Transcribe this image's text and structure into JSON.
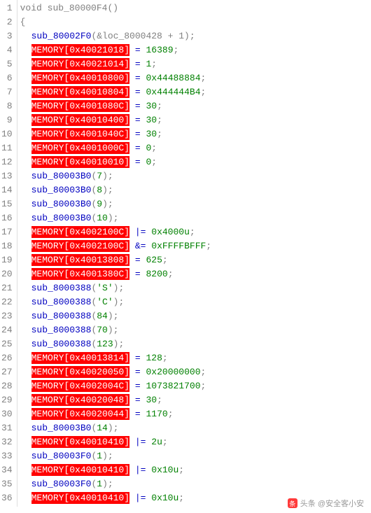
{
  "watermark": "头条 @安全客小安",
  "lines": [
    {
      "n": 1,
      "type": "decl",
      "ret": "void",
      "name": "sub_80000F4",
      "args": "",
      "close": "()"
    },
    {
      "n": 2,
      "type": "brace",
      "text": "{"
    },
    {
      "n": 3,
      "type": "call",
      "fn": "sub_80002F0",
      "args_plain": "(&loc_8000428 + 1);"
    },
    {
      "n": 4,
      "type": "mem",
      "addr": "0x40021018",
      "op": "=",
      "val": "16389"
    },
    {
      "n": 5,
      "type": "mem",
      "addr": "0x40021014",
      "op": "=",
      "val": "1"
    },
    {
      "n": 6,
      "type": "mem",
      "addr": "0x40010800",
      "op": "=",
      "val": "0x44488884"
    },
    {
      "n": 7,
      "type": "mem",
      "addr": "0x40010804",
      "op": "=",
      "val": "0x444444B4"
    },
    {
      "n": 8,
      "type": "mem",
      "addr": "0x4001080C",
      "op": "=",
      "val": "30"
    },
    {
      "n": 9,
      "type": "mem",
      "addr": "0x40010400",
      "op": "=",
      "val": "30"
    },
    {
      "n": 10,
      "type": "mem",
      "addr": "0x4001040C",
      "op": "=",
      "val": "30"
    },
    {
      "n": 11,
      "type": "mem",
      "addr": "0x4001000C",
      "op": "=",
      "val": "0"
    },
    {
      "n": 12,
      "type": "mem",
      "addr": "0x40010010",
      "op": "=",
      "val": "0"
    },
    {
      "n": 13,
      "type": "call",
      "fn": "sub_80003B0",
      "argnum": "7"
    },
    {
      "n": 14,
      "type": "call",
      "fn": "sub_80003B0",
      "argnum": "8"
    },
    {
      "n": 15,
      "type": "call",
      "fn": "sub_80003B0",
      "argnum": "9"
    },
    {
      "n": 16,
      "type": "call",
      "fn": "sub_80003B0",
      "argnum": "10"
    },
    {
      "n": 17,
      "type": "mem",
      "addr": "0x4002100C",
      "op": "|=",
      "val": "0x4000u"
    },
    {
      "n": 18,
      "type": "mem",
      "addr": "0x4002100C",
      "op": "&=",
      "val": "0xFFFFBFFF"
    },
    {
      "n": 19,
      "type": "mem",
      "addr": "0x40013808",
      "op": "=",
      "val": "625"
    },
    {
      "n": 20,
      "type": "mem",
      "addr": "0x4001380C",
      "op": "=",
      "val": "8200"
    },
    {
      "n": 21,
      "type": "call",
      "fn": "sub_8000388",
      "argstr": "'S'"
    },
    {
      "n": 22,
      "type": "call",
      "fn": "sub_8000388",
      "argstr": "'C'"
    },
    {
      "n": 23,
      "type": "call",
      "fn": "sub_8000388",
      "argnum": "84"
    },
    {
      "n": 24,
      "type": "call",
      "fn": "sub_8000388",
      "argnum": "70"
    },
    {
      "n": 25,
      "type": "call",
      "fn": "sub_8000388",
      "argnum": "123"
    },
    {
      "n": 26,
      "type": "mem",
      "addr": "0x40013814",
      "op": "=",
      "val": "128"
    },
    {
      "n": 27,
      "type": "mem",
      "addr": "0x40020050",
      "op": "=",
      "val": "0x20000000"
    },
    {
      "n": 28,
      "type": "mem",
      "addr": "0x4002004C",
      "op": "=",
      "val": "1073821700"
    },
    {
      "n": 29,
      "type": "mem",
      "addr": "0x40020048",
      "op": "=",
      "val": "30"
    },
    {
      "n": 30,
      "type": "mem",
      "addr": "0x40020044",
      "op": "=",
      "val": "1170"
    },
    {
      "n": 31,
      "type": "call",
      "fn": "sub_80003B0",
      "argnum": "14"
    },
    {
      "n": 32,
      "type": "mem",
      "addr": "0x40010410",
      "op": "|=",
      "val": "2u"
    },
    {
      "n": 33,
      "type": "call",
      "fn": "sub_80003F0",
      "argnum": "1"
    },
    {
      "n": 34,
      "type": "mem",
      "addr": "0x40010410",
      "op": "|=",
      "val": "0x10u"
    },
    {
      "n": 35,
      "type": "call",
      "fn": "sub_80003F0",
      "argnum": "1"
    },
    {
      "n": 36,
      "type": "mem",
      "addr": "0x40010410",
      "op": "|=",
      "val": "0x10u"
    }
  ]
}
